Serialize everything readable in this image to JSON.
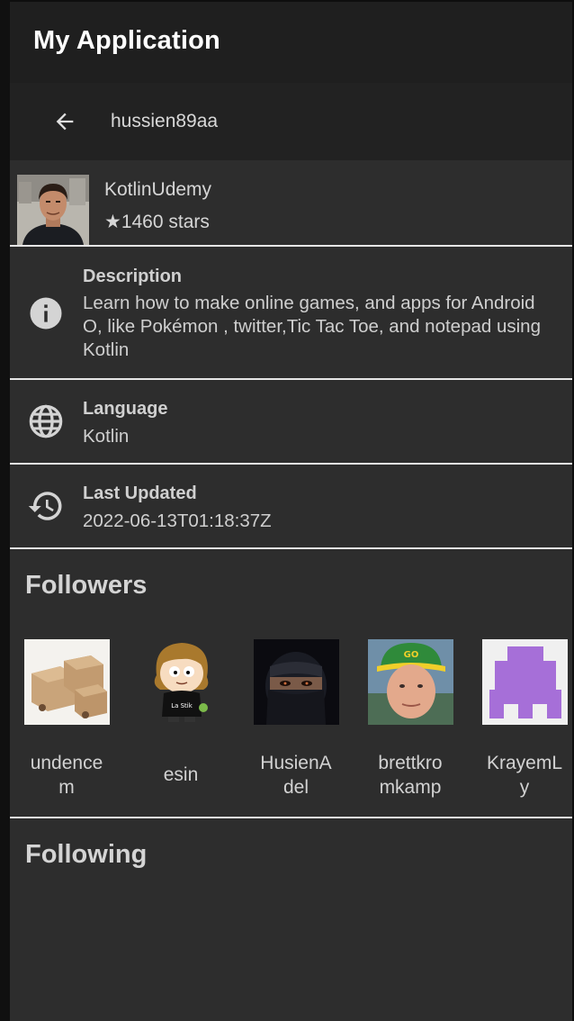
{
  "app": {
    "title": "My Application"
  },
  "toolbar": {
    "title": "hussien89aa",
    "back_icon": "arrow-back-icon"
  },
  "repo": {
    "name": "KotlinUdemy",
    "stars": "★1460 stars"
  },
  "details": {
    "description_label": "Description",
    "description_value": "Learn how to make online games, and apps for Android O, like Pokémon , twitter,Tic Tac Toe, and notepad using Kotlin",
    "language_label": "Language",
    "language_value": "Kotlin",
    "updated_label": "Last Updated",
    "updated_value": "2022-06-13T01:18:37Z",
    "icons": [
      "info-icon",
      "globe-icon",
      "history-icon"
    ]
  },
  "followers": {
    "title": "Followers",
    "items": [
      {
        "name": "undencem",
        "display": "undence\nm"
      },
      {
        "name": "esin",
        "display": "esin"
      },
      {
        "name": "HusienAdel",
        "display": "HusienA\ndel"
      },
      {
        "name": "brettkromkamp",
        "display": "brettkro\nmkamp"
      },
      {
        "name": "KrayemLy",
        "display": "KrayemL\ny"
      }
    ]
  },
  "following": {
    "title": "Following"
  },
  "colors": {
    "background": "#2d2d2d",
    "appbar": "#1f1f1f",
    "toolbar": "#222222",
    "text": "#d6d6d6",
    "divider": "#e6e6e6"
  }
}
